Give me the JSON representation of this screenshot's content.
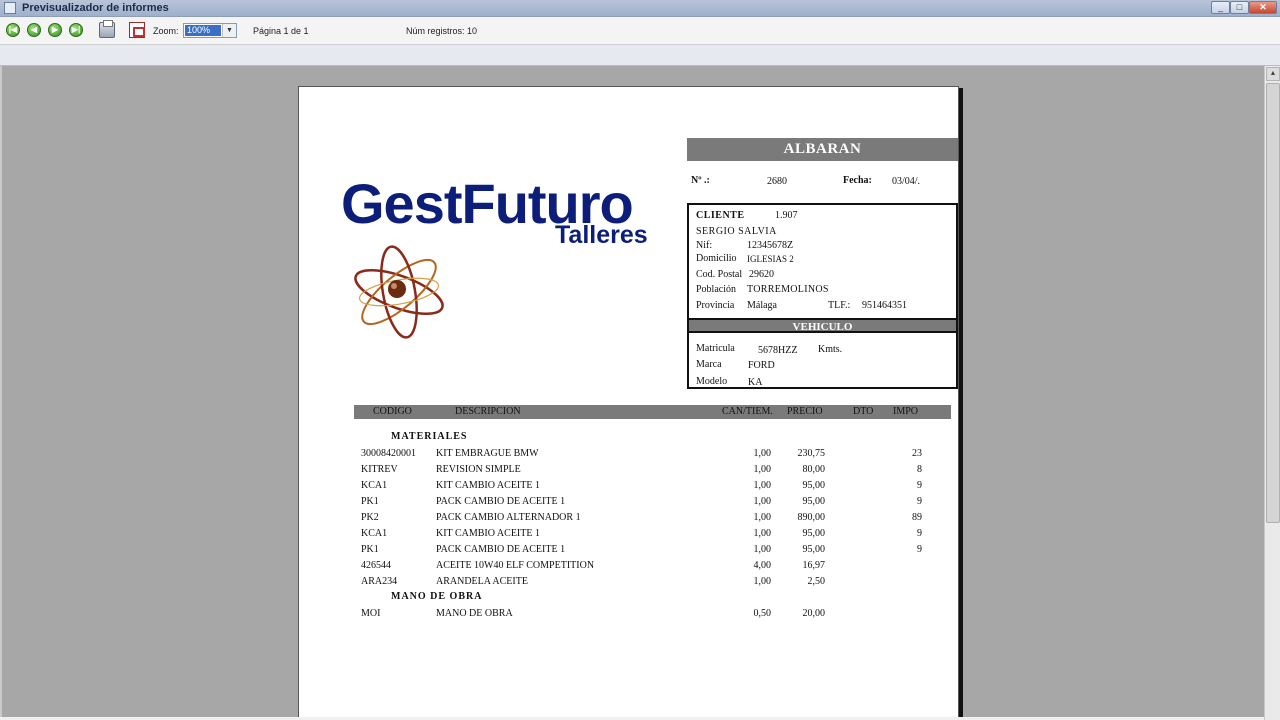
{
  "window": {
    "title": "Previsualizador de informes"
  },
  "toolbar": {
    "zoom_label": "Zoom:",
    "zoom_value": "100%",
    "page_label": "Página 1 de 1",
    "records_label": "Núm registros: 10"
  },
  "report": {
    "logo_main": "GestFuturo",
    "logo_sub": "Talleres",
    "doc_title": "ALBARAN",
    "number_label": "Nº .:",
    "number_value": "2680",
    "date_label": "Fecha:",
    "date_value": "03/04/.",
    "client": {
      "label": "CLIENTE",
      "id": "1.907",
      "name": "SERGIO SALVIA",
      "nif_label": "Nif:",
      "nif": "12345678Z",
      "address_label": "Domicilio",
      "address": "IGLESIAS 2",
      "postal_label": "Cod. Postal",
      "postal": "29620",
      "city_label": "Población",
      "city": "TORREMOLINOS",
      "province_label": "Provincia",
      "province": "Málaga",
      "phone_label": "TLF.:",
      "phone": "951464351"
    },
    "vehicle": {
      "label": "VEHICULO",
      "plate_label": "Matricula",
      "plate": "5678HZZ",
      "kms_label": "Kmts.",
      "brand_label": "Marca",
      "brand": "FORD",
      "model_label": "Modelo",
      "model": "KA"
    },
    "table_headers": {
      "code": "CODIGO",
      "desc": "DESCRIPCION",
      "qty": "CAN/TIEM.",
      "price": "PRECIO",
      "dto": "DTO",
      "imp": "IMPO"
    },
    "section_materials": "MATERIALES",
    "section_labour": "MANO DE OBRA",
    "materials": [
      {
        "code": "30008420001",
        "desc": "KIT EMBRAGUE BMW",
        "qty": "1,00",
        "price": "230,75",
        "imp": "23"
      },
      {
        "code": "KITREV",
        "desc": "REVISION SIMPLE",
        "qty": "1,00",
        "price": "80,00",
        "imp": "8"
      },
      {
        "code": "KCA1",
        "desc": "KIT CAMBIO ACEITE 1",
        "qty": "1,00",
        "price": "95,00",
        "imp": "9"
      },
      {
        "code": "PK1",
        "desc": "PACK CAMBIO DE ACEITE 1",
        "qty": "1,00",
        "price": "95,00",
        "imp": "9"
      },
      {
        "code": "PK2",
        "desc": "PACK CAMBIO ALTERNADOR 1",
        "qty": "1,00",
        "price": "890,00",
        "imp": "89"
      },
      {
        "code": "KCA1",
        "desc": "KIT CAMBIO ACEITE 1",
        "qty": "1,00",
        "price": "95,00",
        "imp": "9"
      },
      {
        "code": "PK1",
        "desc": "PACK CAMBIO DE ACEITE 1",
        "qty": "1,00",
        "price": "95,00",
        "imp": "9"
      },
      {
        "code": "426544",
        "desc": "ACEITE 10W40 ELF COMPETITION",
        "qty": "4,00",
        "price": "16,97",
        "imp": ""
      },
      {
        "code": "ARA234",
        "desc": "ARANDELA ACEITE",
        "qty": "1,00",
        "price": "2,50",
        "imp": ""
      }
    ],
    "labour": [
      {
        "code": "MOI",
        "desc": "MANO DE OBRA",
        "qty": "0,50",
        "price": "20,00",
        "imp": ""
      }
    ]
  }
}
